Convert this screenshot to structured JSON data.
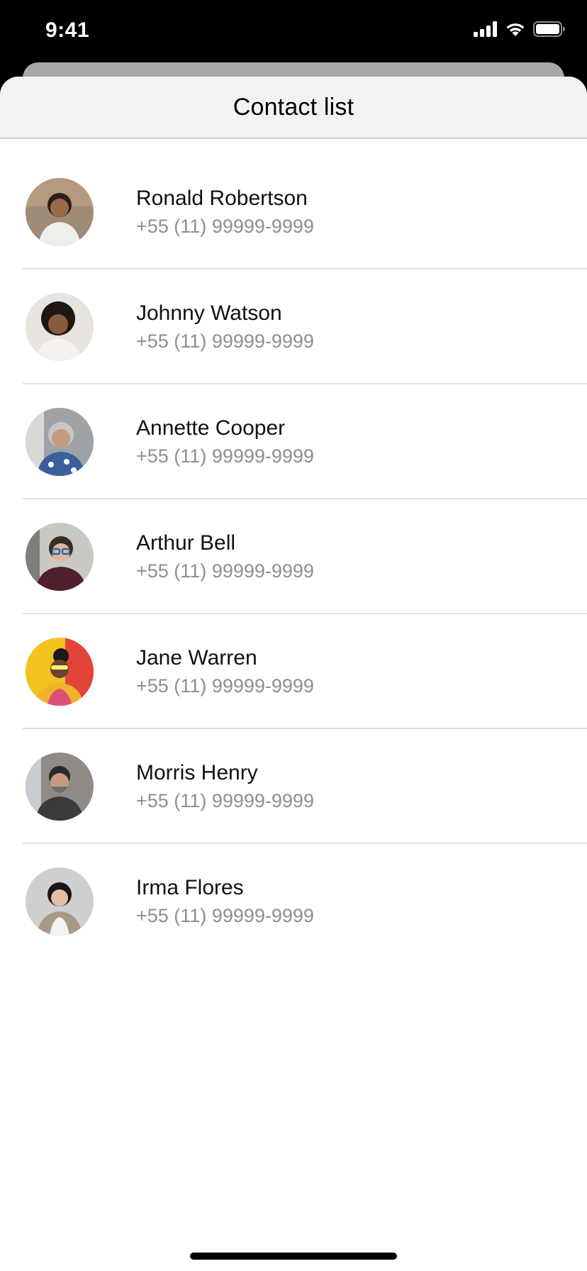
{
  "status_bar": {
    "time": "9:41",
    "icons": [
      "cellular-signal-icon",
      "wifi-icon",
      "battery-icon"
    ]
  },
  "header": {
    "title": "Contact list"
  },
  "contacts": [
    {
      "name": "Ronald Robertson",
      "phone": "+55 (11) 99999-9999",
      "avatar_bg": "#a08b78"
    },
    {
      "name": "Johnny Watson",
      "phone": "+55 (11) 99999-9999",
      "avatar_bg": "#e7e4df"
    },
    {
      "name": "Annette Cooper",
      "phone": "+55 (11) 99999-9999",
      "avatar_bg": "#9ea3a6"
    },
    {
      "name": "Arthur Bell",
      "phone": "+55 (11) 99999-9999",
      "avatar_bg": "#c9c9c4"
    },
    {
      "name": "Jane Warren",
      "phone": "+55 (11) 99999-9999",
      "avatar_bg": "#f3c21f"
    },
    {
      "name": "Morris Henry",
      "phone": "+55 (11) 99999-9999",
      "avatar_bg": "#8f8c88"
    },
    {
      "name": "Irma Flores",
      "phone": "+55 (11) 99999-9999",
      "avatar_bg": "#cfcfcf"
    }
  ],
  "colors": {
    "header_bg": "#f2f2f2",
    "phone_text": "#8e8e93",
    "divider": "#e0e0e0"
  }
}
